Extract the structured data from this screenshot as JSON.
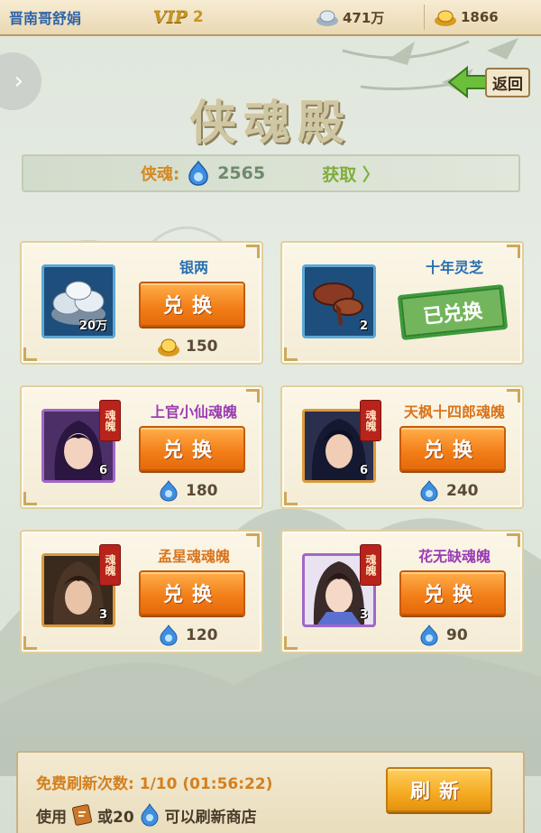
{
  "topbar": {
    "player_name": "晋南哥舒娟",
    "vip_badge": "VIP",
    "vip_level": "2",
    "silver": "471万",
    "gold": "1866"
  },
  "header": {
    "title": "侠魂殿",
    "back_label": "返回"
  },
  "soul_bar": {
    "label": "侠魂:",
    "value": "2565",
    "obtain_label": "获取 〉"
  },
  "items": [
    {
      "name": "银两",
      "count": "20万",
      "button": "兑换",
      "price": "150",
      "price_icon": "gold-ingot-icon",
      "icon": "silver-ingot-icon",
      "redeemed": false
    },
    {
      "name": "十年灵芝",
      "count": "2",
      "stamp": "已兑换",
      "icon": "lingzhi-mushroom-icon",
      "redeemed": true
    },
    {
      "name": "上官小仙魂魄",
      "count": "6",
      "tag": "魂魄",
      "button": "兑换",
      "price": "180",
      "price_icon": "soul-flame-icon",
      "icon": "hero-portrait",
      "redeemed": false
    },
    {
      "name": "天枫十四郎魂魄",
      "count": "6",
      "tag": "魂魄",
      "button": "兑换",
      "price": "240",
      "price_icon": "soul-flame-icon",
      "icon": "hero-portrait",
      "redeemed": false
    },
    {
      "name": "孟星魂魂魄",
      "count": "3",
      "tag": "魂魄",
      "button": "兑换",
      "price": "120",
      "price_icon": "soul-flame-icon",
      "icon": "hero-portrait",
      "redeemed": false
    },
    {
      "name": "花无缺魂魄",
      "count": "3",
      "tag": "魂魄",
      "button": "兑换",
      "price": "90",
      "price_icon": "soul-flame-icon",
      "icon": "hero-portrait",
      "redeemed": false
    }
  ],
  "bottom": {
    "refresh_label": "免费刷新次数:",
    "refresh_value": "1/10 (01:56:22)",
    "hint_use": "使用",
    "hint_or": "或20",
    "hint_end": "可以刷新商店",
    "refresh_button": "刷新"
  },
  "colors": {
    "accent_orange": "#f27d17",
    "blue_name": "#2a6fb1",
    "purple_name": "#9b3db4",
    "orange_name": "#d9751e",
    "stamp_green": "#3c9a3a"
  }
}
